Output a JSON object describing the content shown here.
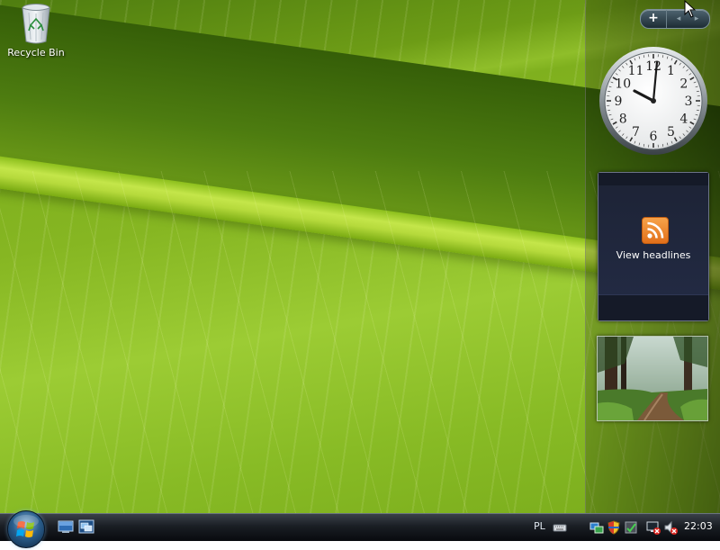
{
  "desktop": {
    "icons": [
      {
        "label": "Recycle Bin",
        "icon": "recycle-bin-icon"
      }
    ]
  },
  "sidebar": {
    "controls": {
      "add_label": "+",
      "prev_label": "◂",
      "next_label": "▸"
    },
    "clock_gadget": {
      "numerals": [
        "12",
        "1",
        "2",
        "3",
        "4",
        "5",
        "6",
        "7",
        "8",
        "9",
        "10",
        "11"
      ],
      "time_shown": "22:03"
    },
    "feed_gadget": {
      "button_label": "View headlines",
      "icon": "rss-icon"
    },
    "slideshow_gadget": {
      "icon": "forest-photo"
    }
  },
  "taskbar": {
    "start_icon": "windows-orb-icon",
    "quick_launch": [
      "show-desktop-icon",
      "switch-windows-icon"
    ],
    "tray": {
      "language": "PL",
      "icons": [
        "keyboard-icon",
        "network-icon",
        "security-shield-icon",
        "update-icon",
        "network-disconnected-icon",
        "volume-muted-icon"
      ],
      "clock": "22:03"
    }
  },
  "colors": {
    "taskbar": "#1a1e24",
    "feed_gadget_bg": "#232b45",
    "rss_orange": "#f7a34a",
    "leaf_green": "#8fbe2a"
  }
}
